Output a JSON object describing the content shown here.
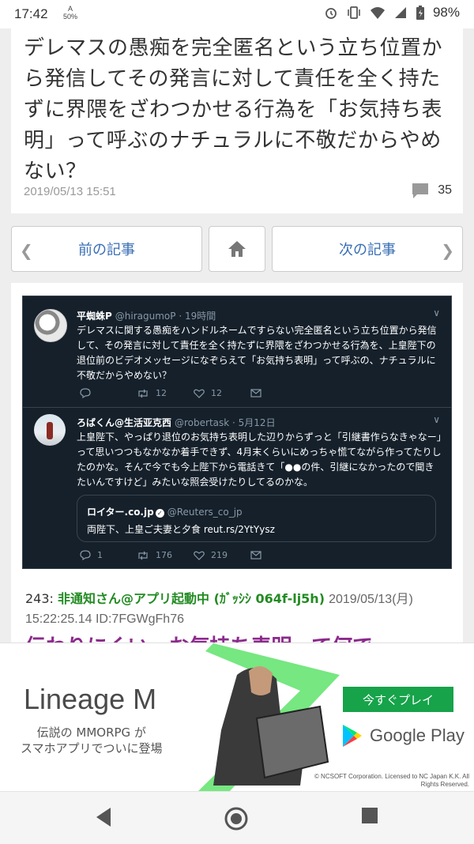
{
  "status_bar": {
    "time": "17:42",
    "net_badge": "50%",
    "battery": "98%",
    "icons": [
      "alarm-icon",
      "vibrate-icon",
      "wifi-icon",
      "signal-icon",
      "battery-icon"
    ]
  },
  "article": {
    "title": "デレマスの愚痴を完全匿名という立ち位置から発信してその発言に対して責任を全く持たずに界隈をざわつかせる行為を「お気持ち表明」って呼ぶのナチュラルに不敬だからやめない？",
    "date": "2019/05/13 15:51",
    "comment_count": "35"
  },
  "nav": {
    "prev_label": "前の記事",
    "next_label": "次の記事"
  },
  "tweets": [
    {
      "name": "平蜘蛛P",
      "handle": "@hiragumoP · 19時間",
      "text": "デレマスに関する愚痴をハンドルネームですらない完全匿名という立ち位置から発信して、その発言に対して責任を全く持たずに界隈をざわつかせる行為を、上皇陛下の退位前のビデオメッセージになぞらえて「お気持ち表明」って呼ぶの、ナチュラルに不敬だからやめない？",
      "replies": "",
      "retweets": "12",
      "likes": "12"
    },
    {
      "name": "ろばくん@生活亚克西",
      "handle": "@robertask · 5月12日",
      "text": "上皇陛下、やっぱり退位のお気持ち表明した辺りからずっと「引継書作らなきゃなー」って思いつつもなかなか着手できず、4月末くらいにめっちゃ慌てながら作ってたりしたのかな。そんで今でも今上陛下から電話きて「●●の件、引継になかったので聞きたいんですけど」みたいな照会受けたりしてるのかな。",
      "replies": "1",
      "retweets": "176",
      "likes": "219",
      "quote": {
        "name": "ロイター.co.jp",
        "handle": "@Reuters_co_jp",
        "text": "両陛下、上皇ご夫妻と夕食 reut.rs/2YtYysz"
      }
    }
  ],
  "res": {
    "number": "243:",
    "name": "非通知さん@アプリ起動中 (ｶﾞｯｼｼ 064f-lj5h)",
    "meta": "2019/05/13(月) 15:22:25.14 ID:7FGWgFh76",
    "body_partial": "伝わりにくい、お気持ち表明って何で"
  },
  "ad": {
    "title": "Lineage M",
    "subtitle_line1": "伝説の MMORPG が",
    "subtitle_line2": "スマホアプリでついに登場",
    "cta": "今すぐプレイ",
    "store": "Google Play",
    "copyright": "© NCSOFT Corporation. Licensed to NC Japan K.K. All Rights Reserved.",
    "accent_color": "#16a34a"
  }
}
